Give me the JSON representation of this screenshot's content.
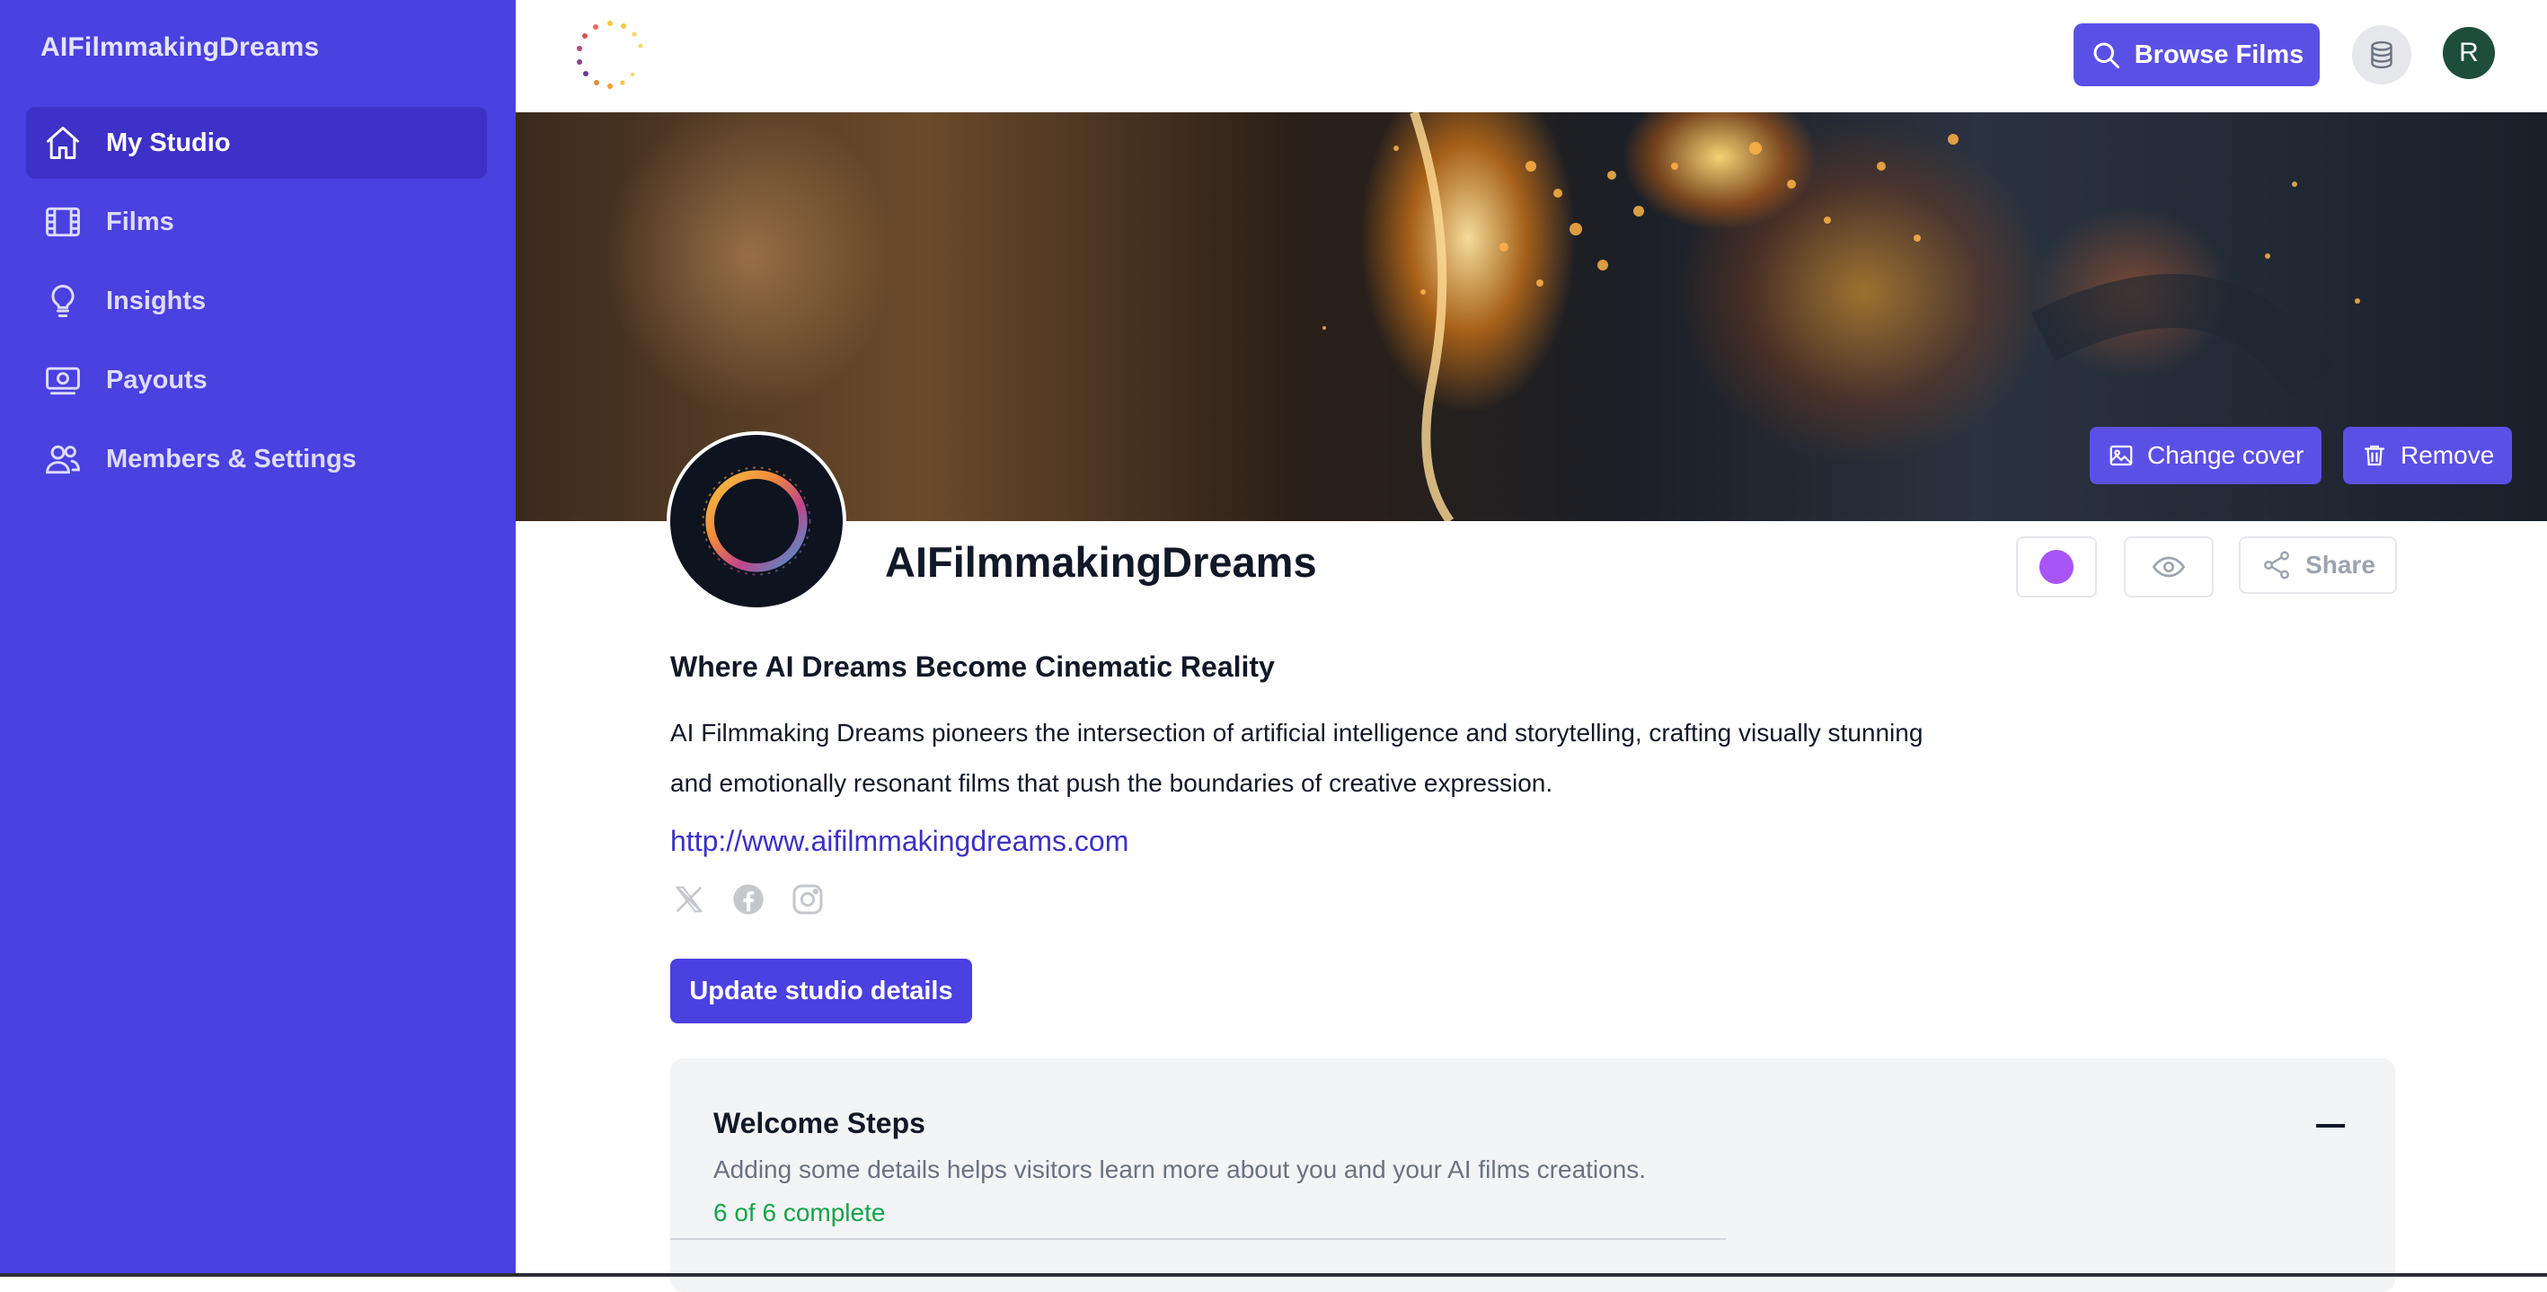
{
  "sidebar": {
    "brand": "AIFilmmakingDreams",
    "items": [
      {
        "label": "My Studio",
        "icon": "home-icon",
        "active": true
      },
      {
        "label": "Films",
        "icon": "film-icon",
        "active": false
      },
      {
        "label": "Insights",
        "icon": "lightbulb-icon",
        "active": false
      },
      {
        "label": "Payouts",
        "icon": "cash-icon",
        "active": false
      },
      {
        "label": "Members & Settings",
        "icon": "users-icon",
        "active": false
      }
    ]
  },
  "topbar": {
    "browse_label": "Browse Films",
    "avatar_initial": "R"
  },
  "cover": {
    "change_label": "Change cover",
    "remove_label": "Remove"
  },
  "profile": {
    "name": "AIFilmmakingDreams",
    "share_label": "Share",
    "accent_color": "#a855f7",
    "tagline": "Where AI Dreams Become Cinematic Reality",
    "description": "AI Filmmaking Dreams pioneers the intersection of artificial intelligence and storytelling, crafting visually stunning and emotionally resonant films that push the boundaries of creative expression.",
    "website": "http://www.aifilmmakingdreams.com",
    "socials": [
      "x-icon",
      "facebook-icon",
      "instagram-icon"
    ],
    "update_label": "Update studio details"
  },
  "welcome": {
    "title": "Welcome Steps",
    "subtitle": "Adding some details helps visitors learn more about you and your AI films creations.",
    "progress": "6 of 6 complete"
  },
  "colors": {
    "sidebar_bg": "#4b40e0",
    "primary": "#5b50e6",
    "success": "#16a34a"
  }
}
